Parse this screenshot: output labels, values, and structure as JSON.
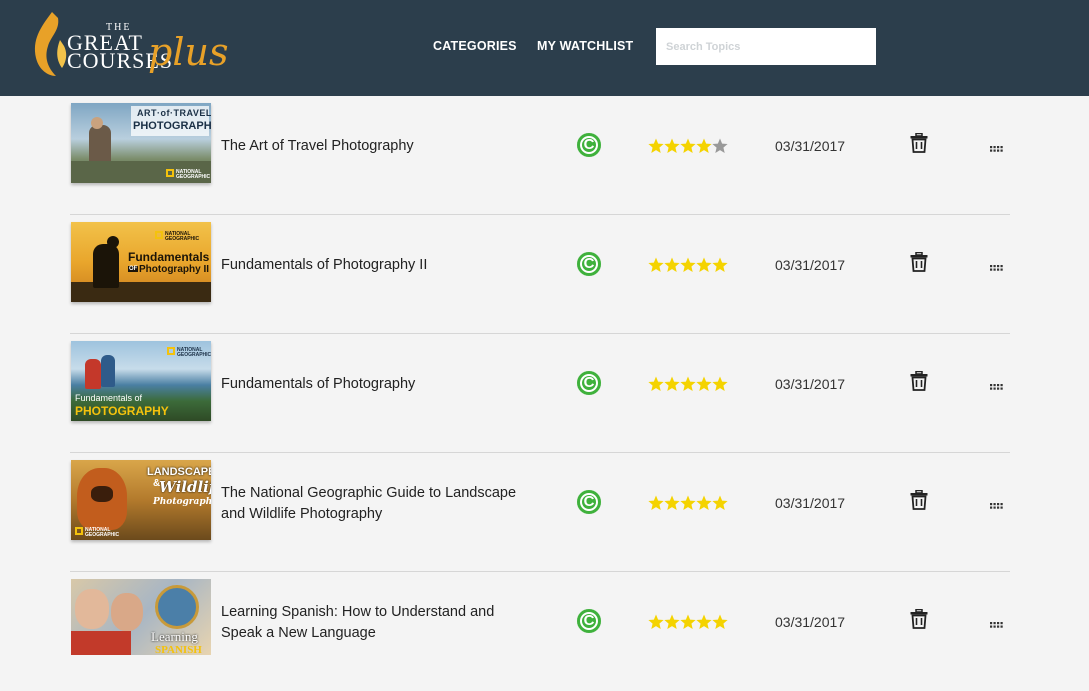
{
  "header": {
    "logo": {
      "the": "THE",
      "great": "GREAT",
      "courses": "COURSES",
      "plus": "plus"
    },
    "nav": {
      "categories": "CATEGORIES",
      "watchlist": "MY WATCHLIST"
    },
    "search": {
      "placeholder": "Search Topics",
      "value": ""
    }
  },
  "colors": {
    "header_bg": "#2c3e4c",
    "accent_orange": "#e8a128",
    "badge_green": "#3fb13c",
    "star_gold": "#f4d300",
    "star_gray": "#999999"
  },
  "rows": [
    {
      "title": "The Art of Travel Photography",
      "rating": 4,
      "date": "03/31/2017",
      "badge": "C",
      "thumb_text": [
        "ART·of·TRAVEL",
        "PHOTOGRAPHY"
      ],
      "thumb_ng": "NATIONAL GEOGRAPHIC"
    },
    {
      "title": "Fundamentals of Photography II",
      "rating": 5,
      "date": "03/31/2017",
      "badge": "C",
      "thumb_text": [
        "Fundamentals",
        "OF",
        "Photography II"
      ],
      "thumb_ng": "NATIONAL GEOGRAPHIC"
    },
    {
      "title": "Fundamentals of Photography",
      "rating": 5,
      "date": "03/31/2017",
      "badge": "C",
      "thumb_text": [
        "Fundamentals of",
        "PHOTOGRAPHY"
      ],
      "thumb_ng": "NATIONAL GEOGRAPHIC"
    },
    {
      "title": "The National Geographic Guide to Landscape and Wildlife Photography",
      "rating": 5,
      "date": "03/31/2017",
      "badge": "C",
      "thumb_text": [
        "LANDSCAPE",
        "&",
        "Wildlife",
        "Photography"
      ],
      "thumb_ng": "NATIONAL GEOGRAPHIC"
    },
    {
      "title": "Learning Spanish: How to Understand and Speak a New Language",
      "rating": 5,
      "date": "03/31/2017",
      "badge": "C",
      "thumb_text": [
        "Learning",
        "SPANISH"
      ]
    }
  ],
  "icons": {
    "trash": "trash-icon",
    "more": "more-dots-icon",
    "badge": "c-badge-icon",
    "star": "star-icon"
  }
}
